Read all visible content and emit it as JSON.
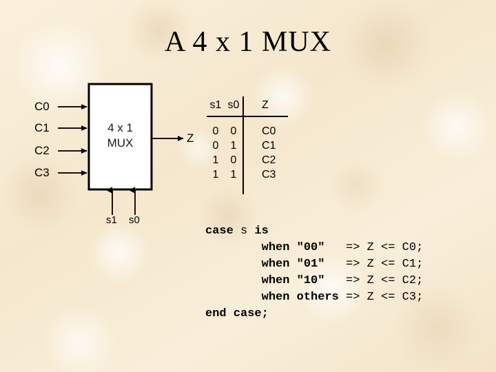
{
  "slide": {
    "title": "A 4 x 1 MUX",
    "background_color": "#f8ecd4",
    "ink_color": "#000000"
  },
  "diagram": {
    "block_label_line1": "4 x 1",
    "block_label_line2": "MUX",
    "block_fill": "#ffffff",
    "block_stroke": "#000000",
    "inputs": [
      {
        "label": "C0"
      },
      {
        "label": "C1"
      },
      {
        "label": "C2"
      },
      {
        "label": "C3"
      }
    ],
    "output": {
      "label": "Z"
    },
    "selects": [
      {
        "label": "s1"
      },
      {
        "label": "s0"
      }
    ]
  },
  "truth_table": {
    "headers": [
      "s1",
      "s0",
      "Z"
    ],
    "rows": [
      {
        "s1": "0",
        "s0": "0",
        "z": "C0"
      },
      {
        "s1": "0",
        "s0": "1",
        "z": "C1"
      },
      {
        "s1": "1",
        "s0": "0",
        "z": "C2"
      },
      {
        "s1": "1",
        "s0": "1",
        "z": "C3"
      }
    ]
  },
  "code": {
    "line1_kw": "case",
    "line1_sel": " s ",
    "line1_kw2": "is",
    "line2_kw": "        when \"00\"   ",
    "line2_op": "=> Z <= C0;",
    "line3_kw": "        when \"01\"   ",
    "line3_op": "=> Z <= C1;",
    "line4_kw": "        when \"10\"   ",
    "line4_op": "=> Z <= C2;",
    "line5_kw": "        when others ",
    "line5_op": "=> Z <= C3;",
    "line6_kw": "end case;"
  }
}
